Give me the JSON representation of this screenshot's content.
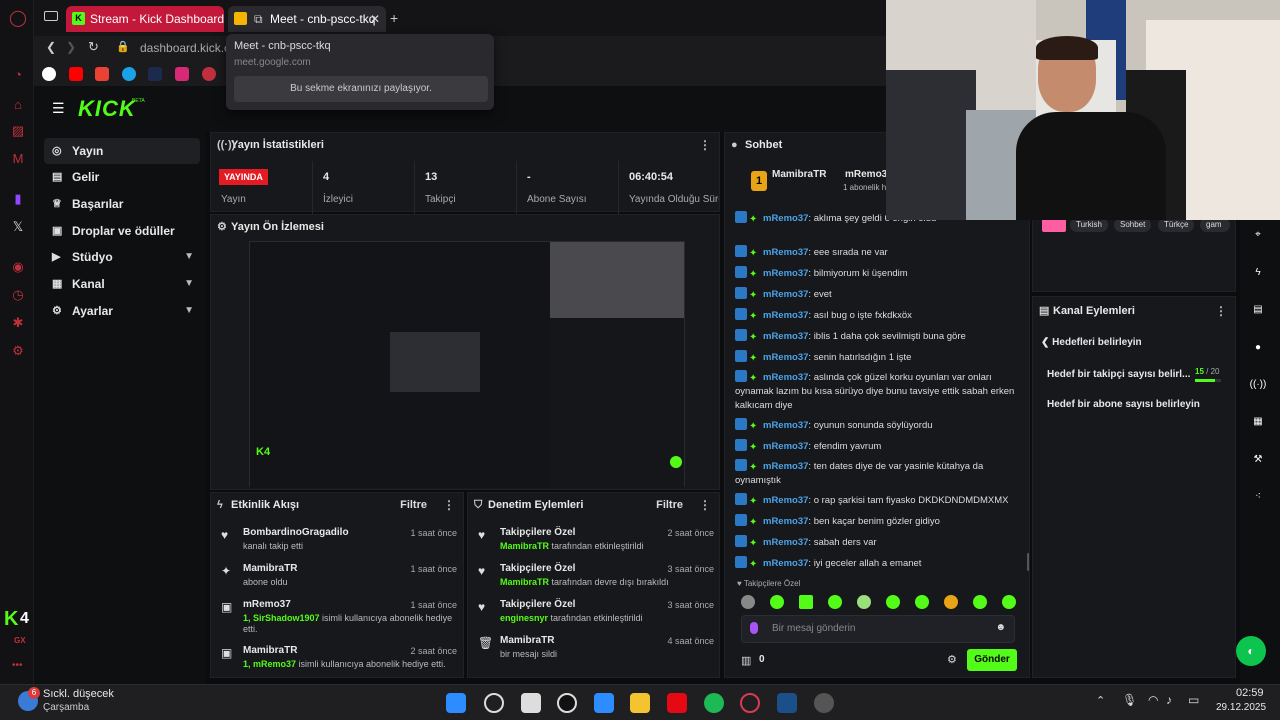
{
  "browser": {
    "tabs": [
      {
        "label": "Stream - Kick Dashboard"
      },
      {
        "label": "Meet - cnb-pscc-tkq"
      }
    ],
    "new_tab_symbol": "+",
    "address": "dashboard.kick.c",
    "popup": {
      "title": "Meet - cnb-pscc-tkq",
      "url": "meet.google.com",
      "sharing_text": "Bu sekme ekranınızı paylaşıyor."
    }
  },
  "kick": {
    "logo": "KICK",
    "logo_badge": "BETA",
    "nav": [
      {
        "label": "Yayın",
        "icon": "broadcast-icon",
        "active": true
      },
      {
        "label": "Gelir",
        "icon": "wallet-icon"
      },
      {
        "label": "Başarılar",
        "icon": "trophy-icon"
      },
      {
        "label": "Droplar ve ödüller",
        "icon": "gift-icon"
      },
      {
        "label": "Stüdyo",
        "icon": "studio-icon",
        "chevron": true
      },
      {
        "label": "Kanal",
        "icon": "channel-icon",
        "chevron": true
      },
      {
        "label": "Ayarlar",
        "icon": "gear-icon",
        "chevron": true
      }
    ],
    "stats": {
      "title": "Yayın İstatistikleri",
      "live_badge": "YAYINDA",
      "items": [
        {
          "value": "",
          "label": "Yayın"
        },
        {
          "value": "4",
          "label": "İzleyici"
        },
        {
          "value": "13",
          "label": "Takipçi"
        },
        {
          "value": "-",
          "label": "Abone Sayısı"
        },
        {
          "value": "06:40:54",
          "label": "Yayında Olduğu Süre"
        }
      ]
    },
    "preview": {
      "title": "Yayın Ön İzlemesi"
    },
    "activity": {
      "title": "Etkinlik Akışı",
      "filter": "Filtre",
      "items": [
        {
          "icon": "heart-icon",
          "title": "BombardinoGragadilo",
          "sub": "kanalı takip etti",
          "time": "1 saat önce"
        },
        {
          "icon": "star-icon",
          "title": "MamibraTR",
          "sub": "abone oldu",
          "time": "1 saat önce"
        },
        {
          "icon": "gift-icon",
          "title": "mRemo37",
          "sub_user": "1, SirShadow1907",
          "sub": " isimli kullanıcıya abonelik hediye etti.",
          "time": "1 saat önce"
        },
        {
          "icon": "gift-icon",
          "title": "MamibraTR",
          "sub_user": "1, mRemo37",
          "sub": " isimli kullanıcıya abonelik hediye etti.",
          "time": "2 saat önce"
        }
      ]
    },
    "moderation": {
      "title": "Denetim Eylemleri",
      "filter": "Filtre",
      "items": [
        {
          "icon": "heart-icon",
          "title": "Takipçilere Özel",
          "sub_user": "MamibraTR",
          "sub": " tarafından etkinleştirildi",
          "time": "2 saat önce"
        },
        {
          "icon": "heart-icon",
          "title": "Takipçilere Özel",
          "sub_user": "MamibraTR",
          "sub": " tarafından devre dışı bırakıldı",
          "time": "3 saat önce"
        },
        {
          "icon": "heart-icon",
          "title": "Takipçilere Özel",
          "sub_user": "enginesnyr",
          "sub": " tarafından etkinleştirildi",
          "time": "3 saat önce"
        },
        {
          "icon": "trash-icon",
          "title": "MamibraTR",
          "sub_user": "",
          "sub": "bir mesajı sildi",
          "time": "4 saat önce"
        }
      ]
    },
    "chat": {
      "title": "Sohbet",
      "top_user1": "MamibraTR",
      "top_user2": "mRemo37",
      "top_user2_sub": "1 abonelik h",
      "messages": [
        {
          "user": "mRemo37",
          "text": ": aklıma şey geldi 6 engin oldu"
        },
        {
          "user": "mRemo37",
          "text": ": eee sırada ne var"
        },
        {
          "user": "mRemo37",
          "text": ": bilmiyorum ki üşendim"
        },
        {
          "user": "mRemo37",
          "text": ": evet"
        },
        {
          "user": "mRemo37",
          "text": ": asıl bug o işte fxkdkxöx"
        },
        {
          "user": "mRemo37",
          "text": ": iblis 1 daha çok sevilmişti buna göre"
        },
        {
          "user": "mRemo37",
          "text": ": senin hatırlsdığın 1 işte"
        },
        {
          "user": "mRemo37",
          "text": ": aslında çok güzel korku oyunları var onları oynamak lazım bu kısa sürüyo diye bunu tavsiye ettik sabah erken kalkıcam diye"
        },
        {
          "user": "mRemo37",
          "text": ": oyunun sonunda söylüyordu"
        },
        {
          "user": "mRemo37",
          "text": ": efendim yavrum"
        },
        {
          "user": "mRemo37",
          "text": ": ten dates diye de var yasinle kütahya da oynamıştık"
        },
        {
          "user": "mRemo37",
          "text": ": o rap şarkisi tam fiyasko DKDKDNDMDMXMX"
        },
        {
          "user": "mRemo37",
          "text": ": ben kaçar benim gözler gidiyo"
        },
        {
          "user": "mRemo37",
          "text": ": sabah ders var"
        },
        {
          "user": "mRemo37",
          "text": ": iyi geceler allah a emanet"
        }
      ],
      "followers_only": "Takipçilere Özel",
      "input_placeholder": "Bir mesaj gönderin",
      "points": "0",
      "send": "Gönder"
    },
    "tags": [
      "Turkish",
      "Sohbet",
      "Türkçe",
      "gam"
    ],
    "channel_actions": {
      "title": "Kanal Eylemleri",
      "back_title": "Hedefleri belirleyin",
      "goal1": "Hedef bir takipçi sayısı belirl...",
      "goal1_progress": "15",
      "goal1_total": " / 20",
      "goal1_fraction": 0.75,
      "goal2": "Hedef bir abone sayısı belirleyin"
    }
  },
  "opera_gx": {
    "viewer_count": "4",
    "brand": "GX"
  },
  "taskbar": {
    "weather_badge": "6",
    "weather_title": "Sıckl. düşecek",
    "weather_sub": "Çarşamba",
    "time": "02:59",
    "date": "29.12.2025"
  },
  "colors": {
    "kick_green": "#53fc18",
    "live_red": "#e41b23",
    "opera_red": "#c0303c"
  }
}
